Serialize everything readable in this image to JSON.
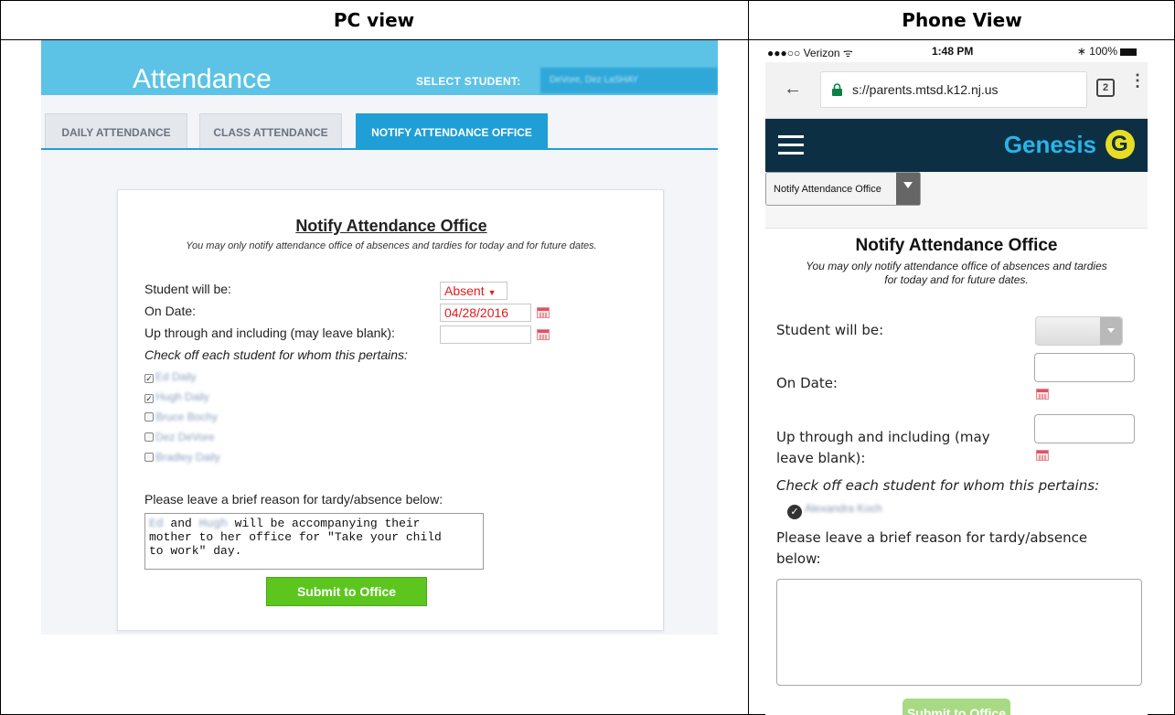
{
  "columns": {
    "pc_title": "PC view",
    "phone_title": "Phone View"
  },
  "pc": {
    "app_title": "Attendance",
    "select_student_label": "SELECT STUDENT:",
    "selected_student": "DeVore, Dez LaSHAY",
    "tabs": [
      {
        "label": "DAILY ATTENDANCE",
        "active": false
      },
      {
        "label": "CLASS ATTENDANCE",
        "active": false
      },
      {
        "label": "NOTIFY ATTENDANCE OFFICE",
        "active": true
      }
    ],
    "form": {
      "title": "Notify Attendance Office",
      "subtitle": "You may only notify attendance office of absences and tardies for today and for future dates.",
      "student_will_be_label": "Student will be:",
      "student_will_be_value": "Absent",
      "on_date_label": "On Date:",
      "on_date_value": "04/28/2016",
      "through_label": "Up through and including (may leave blank):",
      "through_value": "",
      "check_label": "Check off each student for whom this pertains:",
      "students": [
        {
          "name": "Ed Daily",
          "checked": true
        },
        {
          "name": "Hugh Daily",
          "checked": true
        },
        {
          "name": "Bruce Bochy",
          "checked": false
        },
        {
          "name": "Dez DeVore",
          "checked": false
        },
        {
          "name": "Bradley Daily",
          "checked": false
        }
      ],
      "reason_label": "Please leave a brief reason for tardy/absence below:",
      "reason_name1": "Ed",
      "reason_text1": " and ",
      "reason_name2": "Hugh",
      "reason_text2": " will be accompanying their\nmother to her office for \"Take your child\nto work\" day.",
      "submit_label": "Submit to Office"
    },
    "colors": {
      "topbar": "#5cc3e6",
      "active_tab": "#1f9fd6",
      "submit": "#5cc61f"
    }
  },
  "phone": {
    "status": {
      "carrier": "●●●○○ Verizon ᯤ",
      "time": "1:48 PM",
      "battery": "∗ 100%"
    },
    "browser": {
      "back_icon": "←",
      "url": "s://parents.mtsd.k12.nj.us",
      "tab_count": "2",
      "menu_icon": "⋮"
    },
    "logo_text": "Genesis",
    "page_dropdown": "Notify Attendance Office",
    "form": {
      "title": "Notify Attendance Office",
      "subtitle": "You may only notify attendance office of absences and tardies for today and for future dates.",
      "student_will_be_label": "Student will be:",
      "on_date_label": "On Date:",
      "through_label": "Up through and including (may leave blank):",
      "check_label": "Check off each student for whom this pertains:",
      "student": "Alexandra Koch",
      "student_checked_glyph": "✓",
      "reason_label": "Please leave a brief reason for tardy/absence below:",
      "submit_label": "Submit to Office"
    },
    "colors": {
      "navbar": "#0d2f44",
      "logo": "#29b4e8",
      "logo_mark": "#e8dd23",
      "submit": "#a8da84"
    }
  }
}
